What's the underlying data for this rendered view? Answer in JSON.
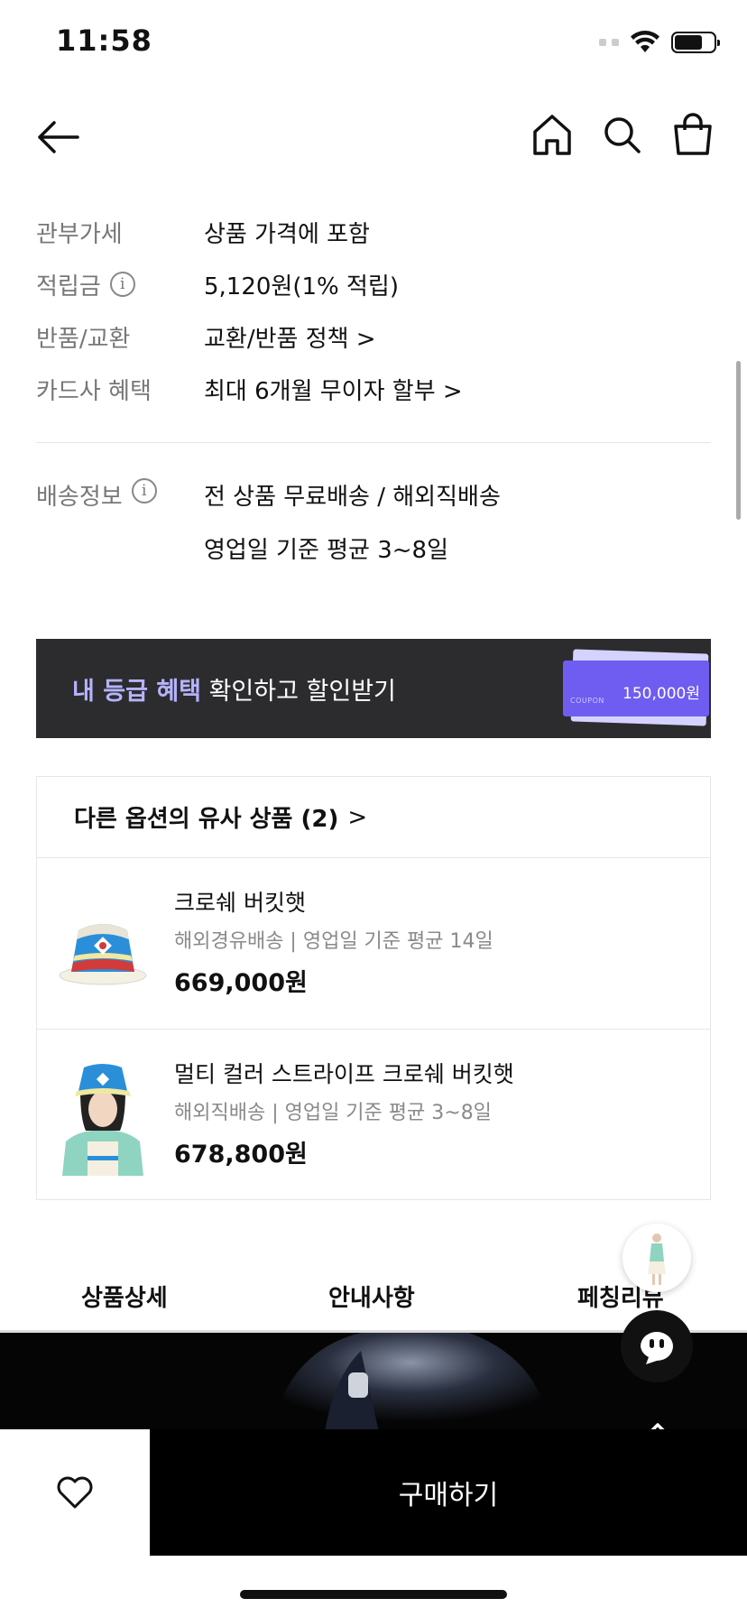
{
  "status_bar": {
    "time": "11:58"
  },
  "nav": {
    "icons": [
      "back-arrow-icon",
      "home-icon",
      "search-icon",
      "shopping-bag-icon"
    ]
  },
  "info": [
    {
      "label": "관부가세",
      "value": "상품 가격에 포함",
      "has_info": false
    },
    {
      "label": "적립금",
      "value": "5,120원(1% 적립)",
      "has_info": true
    },
    {
      "label": "반품/교환",
      "value": "교환/반품 정책 >",
      "has_info": false
    },
    {
      "label": "카드사 혜택",
      "value": "최대 6개월 무이자 할부 >",
      "has_info": false
    }
  ],
  "shipping": {
    "label": "배송정보",
    "lines": [
      "전 상품 무료배송 / 해외직배송",
      "영업일 기준 평균 3~8일"
    ]
  },
  "grade_banner": {
    "highlight": "내 등급 혜택",
    "text": " 확인하고 할인받기",
    "coupon_small": "COUPON",
    "coupon_amount": "150,000원"
  },
  "similar": {
    "title": "다른 옵션의 유사 상품 (2)",
    "chevron": ">",
    "products": [
      {
        "name": "크로쉐 버킷햇",
        "shipping": "해외경유배송 | 영업일 기준 평균 14일",
        "price": "669,000원"
      },
      {
        "name": "멀티 컬러 스트라이프 크로쉐 버킷햇",
        "shipping": "해외직배송 | 영업일 기준 평균 3~8일",
        "price": "678,800원"
      }
    ]
  },
  "tabs": [
    "상품상세",
    "안내사항",
    "페칭리뷰"
  ],
  "bottom": {
    "buy_label": "구매하기"
  },
  "colors": {
    "accent": "#b6b3ff",
    "banner_bg": "#2c2c2e",
    "coupon": "#6f5cf0"
  }
}
